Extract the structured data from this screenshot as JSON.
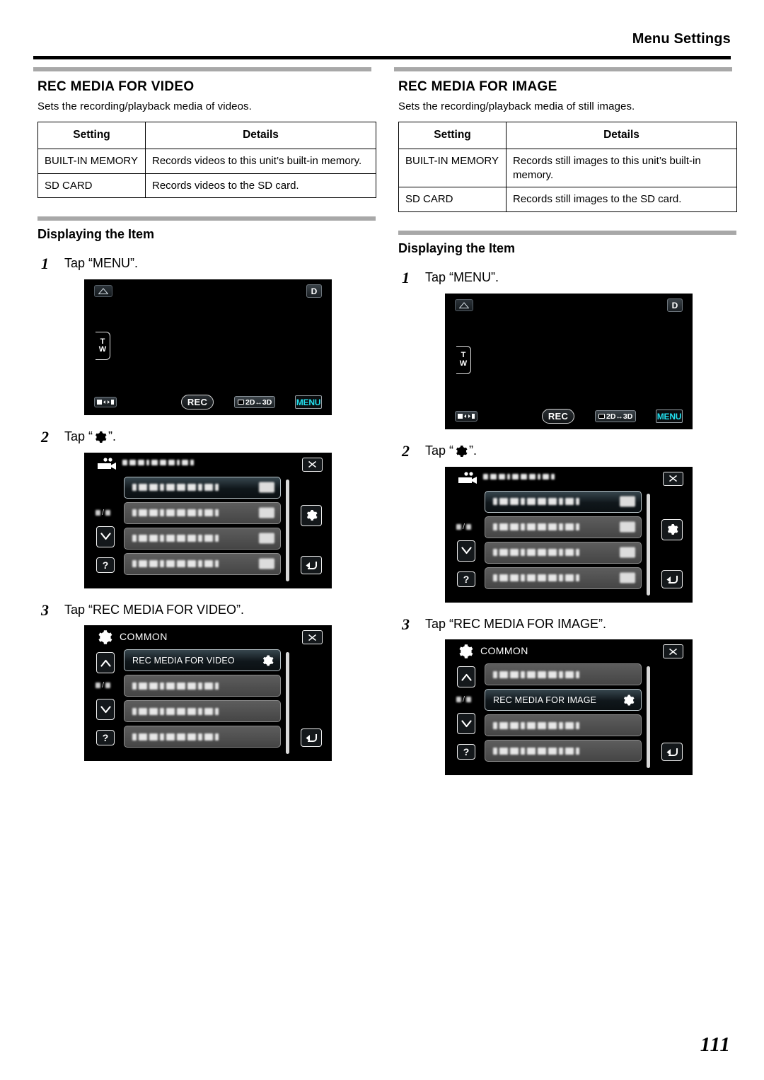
{
  "header": {
    "title": "Menu Settings"
  },
  "footer": {
    "page_number": "111"
  },
  "columns": [
    {
      "id": "rec-media-for-video",
      "section_title": "REC MEDIA FOR VIDEO",
      "description": "Sets the recording/playback media of videos.",
      "table": {
        "headers": [
          "Setting",
          "Details"
        ],
        "rows": [
          {
            "setting": "BUILT-IN MEMORY",
            "details": "Records videos to this unit’s built-in memory."
          },
          {
            "setting": "SD CARD",
            "details": "Records videos to the SD card."
          }
        ]
      },
      "procedure_title": "Displaying the Item",
      "steps": [
        {
          "number": "1",
          "text_before": "Tap “MENU”.",
          "icon": null,
          "text_after": ""
        },
        {
          "number": "2",
          "text_before": "Tap “",
          "icon": "gear-icon",
          "text_after": "”."
        },
        {
          "number": "3",
          "text_before": "Tap “REC MEDIA FOR VIDEO”.",
          "icon": null,
          "text_after": ""
        }
      ],
      "camera_screen": {
        "top_left_icon": "stabilizer-icon",
        "top_right_label": "D",
        "zoom_top": "T",
        "zoom_bottom": "W",
        "playback_mode_icon": "record-playback-switch-icon",
        "rec_label": "REC",
        "mode_2d3d_label": "2D↔3D",
        "menu_label": "MENU",
        "menu_color": "#22e0ef"
      },
      "menu_screen": {
        "head_icon": "video-camera-icon",
        "head_title": "",
        "head_title_blurred": true,
        "close_icon": "close-icon",
        "side_gear_icon": "gear-icon",
        "back_icon": "back-arrow-icon",
        "down_icon": "chevron-down-icon",
        "help_label": "?",
        "page_indicator": "/",
        "rows": [
          {
            "label": "",
            "blurred": true,
            "selected": true,
            "thumb": true
          },
          {
            "label": "",
            "blurred": true,
            "selected": false,
            "thumb": true
          },
          {
            "label": "",
            "blurred": true,
            "selected": false,
            "thumb": true
          },
          {
            "label": "",
            "blurred": true,
            "selected": false,
            "thumb": true
          }
        ]
      },
      "common_screen": {
        "head_icon": "gear-icon",
        "head_title": "COMMON",
        "close_icon": "close-icon",
        "up_icon": "chevron-up-icon",
        "down_icon": "chevron-down-icon",
        "back_icon": "back-arrow-icon",
        "help_label": "?",
        "page_indicator": "/",
        "rows": [
          {
            "label": "REC MEDIA FOR VIDEO",
            "blurred": false,
            "selected": true,
            "gear": true
          },
          {
            "label": "",
            "blurred": true,
            "selected": false,
            "gear": false
          },
          {
            "label": "",
            "blurred": true,
            "selected": false,
            "gear": false
          },
          {
            "label": "",
            "blurred": true,
            "selected": false,
            "gear": false
          }
        ]
      }
    },
    {
      "id": "rec-media-for-image",
      "section_title": "REC MEDIA FOR IMAGE",
      "description": "Sets the recording/playback media of still images.",
      "table": {
        "headers": [
          "Setting",
          "Details"
        ],
        "rows": [
          {
            "setting": "BUILT-IN MEMORY",
            "details": "Records still images to this unit’s built-in memory."
          },
          {
            "setting": "SD CARD",
            "details": "Records still images to the SD card."
          }
        ]
      },
      "procedure_title": "Displaying the Item",
      "steps": [
        {
          "number": "1",
          "text_before": "Tap “MENU”.",
          "icon": null,
          "text_after": ""
        },
        {
          "number": "2",
          "text_before": "Tap “",
          "icon": "gear-icon",
          "text_after": "”."
        },
        {
          "number": "3",
          "text_before": "Tap “REC MEDIA FOR IMAGE”.",
          "icon": null,
          "text_after": ""
        }
      ],
      "camera_screen": {
        "top_left_icon": "stabilizer-icon",
        "top_right_label": "D",
        "zoom_top": "T",
        "zoom_bottom": "W",
        "playback_mode_icon": "record-playback-switch-icon",
        "rec_label": "REC",
        "mode_2d3d_label": "2D↔3D",
        "menu_label": "MENU",
        "menu_color": "#22e0ef"
      },
      "menu_screen": {
        "head_icon": "video-camera-icon",
        "head_title": "",
        "head_title_blurred": true,
        "close_icon": "close-icon",
        "side_gear_icon": "gear-icon",
        "back_icon": "back-arrow-icon",
        "down_icon": "chevron-down-icon",
        "help_label": "?",
        "page_indicator": "/",
        "rows": [
          {
            "label": "",
            "blurred": true,
            "selected": true,
            "thumb": true
          },
          {
            "label": "",
            "blurred": true,
            "selected": false,
            "thumb": true
          },
          {
            "label": "",
            "blurred": true,
            "selected": false,
            "thumb": true
          },
          {
            "label": "",
            "blurred": true,
            "selected": false,
            "thumb": true
          }
        ]
      },
      "common_screen": {
        "head_icon": "gear-icon",
        "head_title": "COMMON",
        "close_icon": "close-icon",
        "up_icon": "chevron-up-icon",
        "down_icon": "chevron-down-icon",
        "back_icon": "back-arrow-icon",
        "help_label": "?",
        "page_indicator": "/",
        "rows": [
          {
            "label": "",
            "blurred": true,
            "selected": false,
            "gear": false
          },
          {
            "label": "REC MEDIA FOR IMAGE",
            "blurred": false,
            "selected": true,
            "gear": true
          },
          {
            "label": "",
            "blurred": true,
            "selected": false,
            "gear": false
          },
          {
            "label": "",
            "blurred": true,
            "selected": false,
            "gear": false
          }
        ]
      }
    }
  ]
}
